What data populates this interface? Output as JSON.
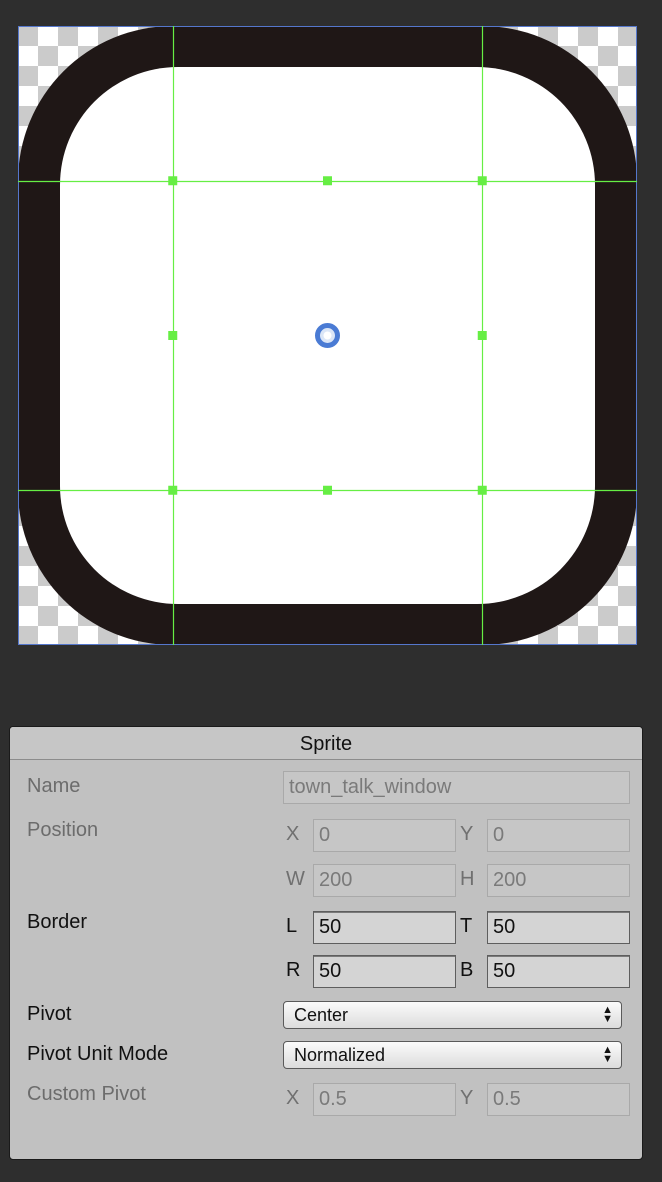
{
  "sprite_editor": {
    "handle_points": [
      [
        "top-left",
        0.25,
        0.25
      ],
      [
        "top-center",
        0.5,
        0.25
      ],
      [
        "top-right",
        0.75,
        0.25
      ],
      [
        "middle-left",
        0.25,
        0.5
      ],
      [
        "middle-right",
        0.75,
        0.5
      ],
      [
        "bottom-left",
        0.25,
        0.75
      ],
      [
        "bottom-center",
        0.5,
        0.75
      ],
      [
        "bottom-right",
        0.75,
        0.75
      ]
    ],
    "colors": {
      "background": "#2e2e2e",
      "sprite_border": "#1f1716",
      "sprite_fill": "#ffffff",
      "guide_lines": "#66ee44",
      "pivot": "#4a7bd4",
      "selection_outline": "#5577cc"
    }
  },
  "inspector": {
    "title": "Sprite",
    "name": {
      "label": "Name",
      "value": "town_talk_window"
    },
    "position": {
      "label": "Position",
      "x": {
        "axis": "X",
        "value": "0"
      },
      "y": {
        "axis": "Y",
        "value": "0"
      },
      "w": {
        "axis": "W",
        "value": "200"
      },
      "h": {
        "axis": "H",
        "value": "200"
      }
    },
    "border": {
      "label": "Border",
      "l": {
        "axis": "L",
        "value": "50"
      },
      "t": {
        "axis": "T",
        "value": "50"
      },
      "r": {
        "axis": "R",
        "value": "50"
      },
      "b": {
        "axis": "B",
        "value": "50"
      }
    },
    "pivot": {
      "label": "Pivot",
      "value": "Center"
    },
    "pivot_unit_mode": {
      "label": "Pivot Unit Mode",
      "value": "Normalized"
    },
    "custom_pivot": {
      "label": "Custom Pivot",
      "x": {
        "axis": "X",
        "value": "0.5"
      },
      "y": {
        "axis": "Y",
        "value": "0.5"
      }
    },
    "colors": {
      "panel": "#c1c1c1",
      "label_disabled": "#6c6c6c",
      "label_enabled": "#111111"
    }
  }
}
